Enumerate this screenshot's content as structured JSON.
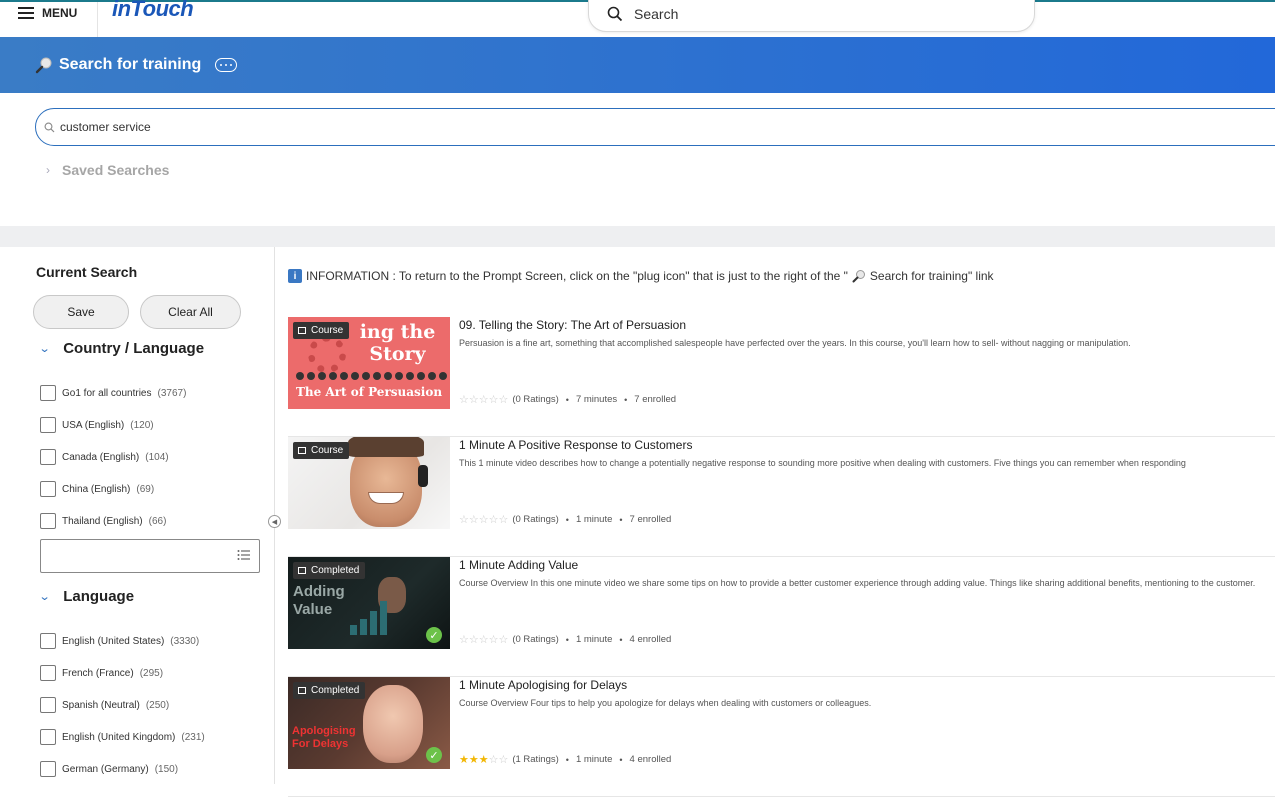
{
  "topbar": {
    "menu_label": "MENU",
    "logo_text": "inTouch",
    "search_placeholder": "Search"
  },
  "banner": {
    "title": "Search for training"
  },
  "search": {
    "query": "customer service",
    "saved_searches_label": "Saved Searches"
  },
  "sidebar": {
    "current_search_label": "Current Search",
    "save_label": "Save",
    "clear_all_label": "Clear All",
    "facets": [
      {
        "title": "Country / Language",
        "items": [
          {
            "label": "Go1 for all countries",
            "count": "(3767)"
          },
          {
            "label": "USA (English)",
            "count": "(120)"
          },
          {
            "label": "Canada (English)",
            "count": "(104)"
          },
          {
            "label": "China (English)",
            "count": "(69)"
          },
          {
            "label": "Thailand (English)",
            "count": "(66)"
          }
        ]
      },
      {
        "title": "Language",
        "items": [
          {
            "label": "English (United States)",
            "count": "(3330)"
          },
          {
            "label": "French (France)",
            "count": "(295)"
          },
          {
            "label": "Spanish (Neutral)",
            "count": "(250)"
          },
          {
            "label": "English (United Kingdom)",
            "count": "(231)"
          },
          {
            "label": "German (Germany)",
            "count": "(150)"
          }
        ]
      }
    ]
  },
  "results": {
    "info_text": "INFORMATION :  To return to the Prompt Screen, click on the \"plug icon\" that is just to the right of the \"",
    "info_link_text": "Search for training\" link",
    "items": [
      {
        "badge": "Course",
        "title": "09. Telling the Story: The Art of Persuasion",
        "description": "Persuasion is a fine art, something that accomplished salespeople have perfected over the years. In this course, you'll learn how to sell- without nagging or manipulation.",
        "rating": 0,
        "ratings_text": "(0 Ratings)",
        "duration": "7 minutes",
        "enrolled": "7 enrolled",
        "thumb_text_main": "ing the Story",
        "thumb_text_sub": "The Art of Persuasion"
      },
      {
        "badge": "Course",
        "title": "1 Minute A Positive Response to Customers",
        "description": "This 1 minute video describes how to change a potentially negative response to sounding more positive when dealing with customers. Five things you can remember when responding",
        "rating": 0,
        "ratings_text": "(0 Ratings)",
        "duration": "1 minute",
        "enrolled": "7 enrolled"
      },
      {
        "badge": "Completed",
        "title": "1 Minute Adding Value",
        "description": "Course Overview In this one minute video we share some tips on how to provide a better customer experience through adding value. Things like sharing additional benefits, mentioning to the customer.",
        "rating": 0,
        "ratings_text": "(0 Ratings)",
        "duration": "1 minute",
        "enrolled": "4 enrolled",
        "thumb_text_main": "Adding Value"
      },
      {
        "badge": "Completed",
        "title": "1 Minute Apologising for Delays",
        "description": "Course Overview Four tips to help you apologize for delays when dealing with customers or colleagues.",
        "rating": 3,
        "ratings_text": "(1 Ratings)",
        "duration": "1 minute",
        "enrolled": "4 enrolled",
        "thumb_text_main": "Apologising For Delays"
      }
    ]
  }
}
